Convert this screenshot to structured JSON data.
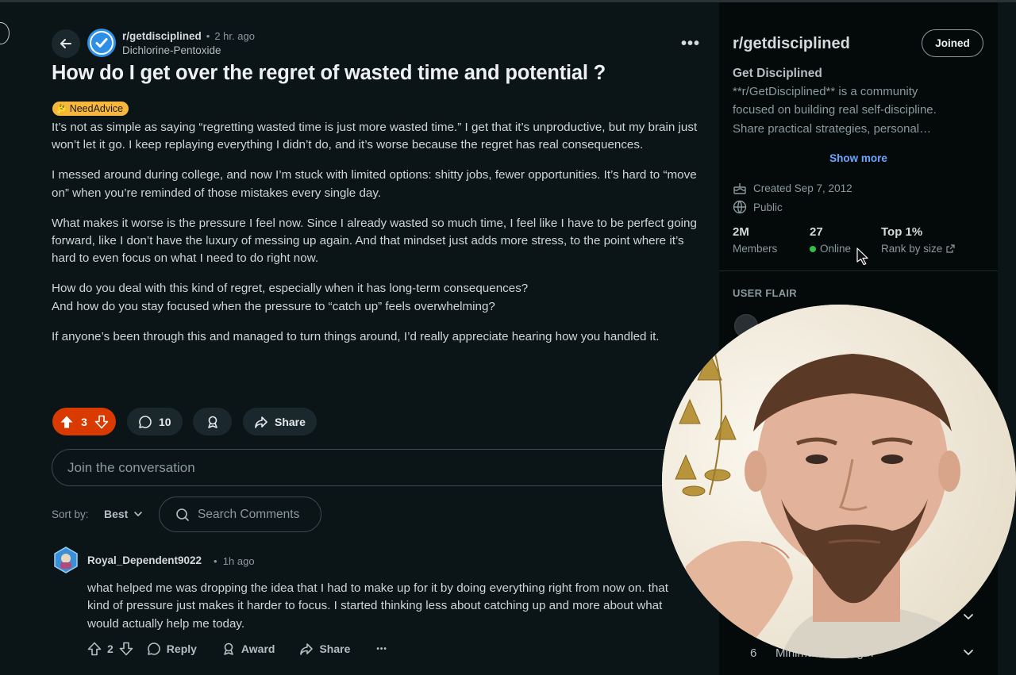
{
  "post": {
    "subreddit": "r/getdisciplined",
    "time_ago": "2 hr. ago",
    "separator": "•",
    "author": "Dichlorine-Pentoxide",
    "more_label": "•••",
    "title": "How do I get over the regret of wasted time and potential ?",
    "flair_emoji": "🤔",
    "flair": "NeedAdvice",
    "paragraphs": [
      "It’s not as simple as saying “regretting wasted time is just more wasted time.” I get that it’s unproductive, but my brain just won’t let it go. I keep replaying everything I didn’t do, and it’s worse because the regret has real consequences.",
      "I messed around during college, and now I’m stuck with limited options: shitty jobs, fewer opportunities. It’s hard to “move on” when you’re reminded of those mistakes every single day.",
      "What makes it worse is the pressure I feel now. Since I already wasted so much time, I feel like I have to be perfect going forward, like I don’t have the luxury of messing up again. And that mindset just adds more stress, to the point where it’s hard to even focus on what I need to do right now.",
      "How do you deal with this kind of regret, especially when it has long-term consequences?\nAnd how do you stay focused when the pressure to “catch up” feels overwhelming?",
      "If anyone’s been through this and managed to turn things around, I’d really appreciate hearing how you handled it."
    ],
    "votes": "3",
    "comments": "10",
    "share_label": "Share"
  },
  "composer": {
    "placeholder": "Join the conversation"
  },
  "sort": {
    "label": "Sort by:",
    "value": "Best",
    "search_placeholder": "Search Comments"
  },
  "comment": {
    "author": "Royal_Dependent9022",
    "time_ago": "1h ago",
    "separator": "•",
    "text": "what helped me was dropping the idea that I had to make up for it by doing everything right from now on. that kind of pressure just makes it harder to focus. I started thinking less about catching up and more about what would actually help me today.",
    "votes": "2",
    "reply_label": "Reply",
    "award_label": "Award",
    "share_label": "Share",
    "more_label": "•••"
  },
  "sidebar": {
    "title": "r/getdisciplined",
    "joined_label": "Joined",
    "name": "Get Disciplined",
    "description": "**r/GetDisciplined** is a community focused on building real self-discipline. Share practical strategies, personal…",
    "show_more": "Show more",
    "created": "Created Sep 7, 2012",
    "visibility": "Public",
    "stats": {
      "members_value": "2M",
      "members_label": "Members",
      "online_value": "27",
      "online_label": "Online",
      "rank_value": "Top 1%",
      "rank_label": "Rank by size"
    },
    "user_flair_label": "USER FLAIR",
    "rules": [
      {
        "num": "6",
        "text": "Minimu... ...Length"
      }
    ]
  },
  "colors": {
    "background": "#0b1416",
    "sidebar": "#04090a",
    "upvote_active": "#d93a00",
    "link": "#6aa7ff",
    "online": "#2fbf4a",
    "flair": "#f6b73c"
  }
}
